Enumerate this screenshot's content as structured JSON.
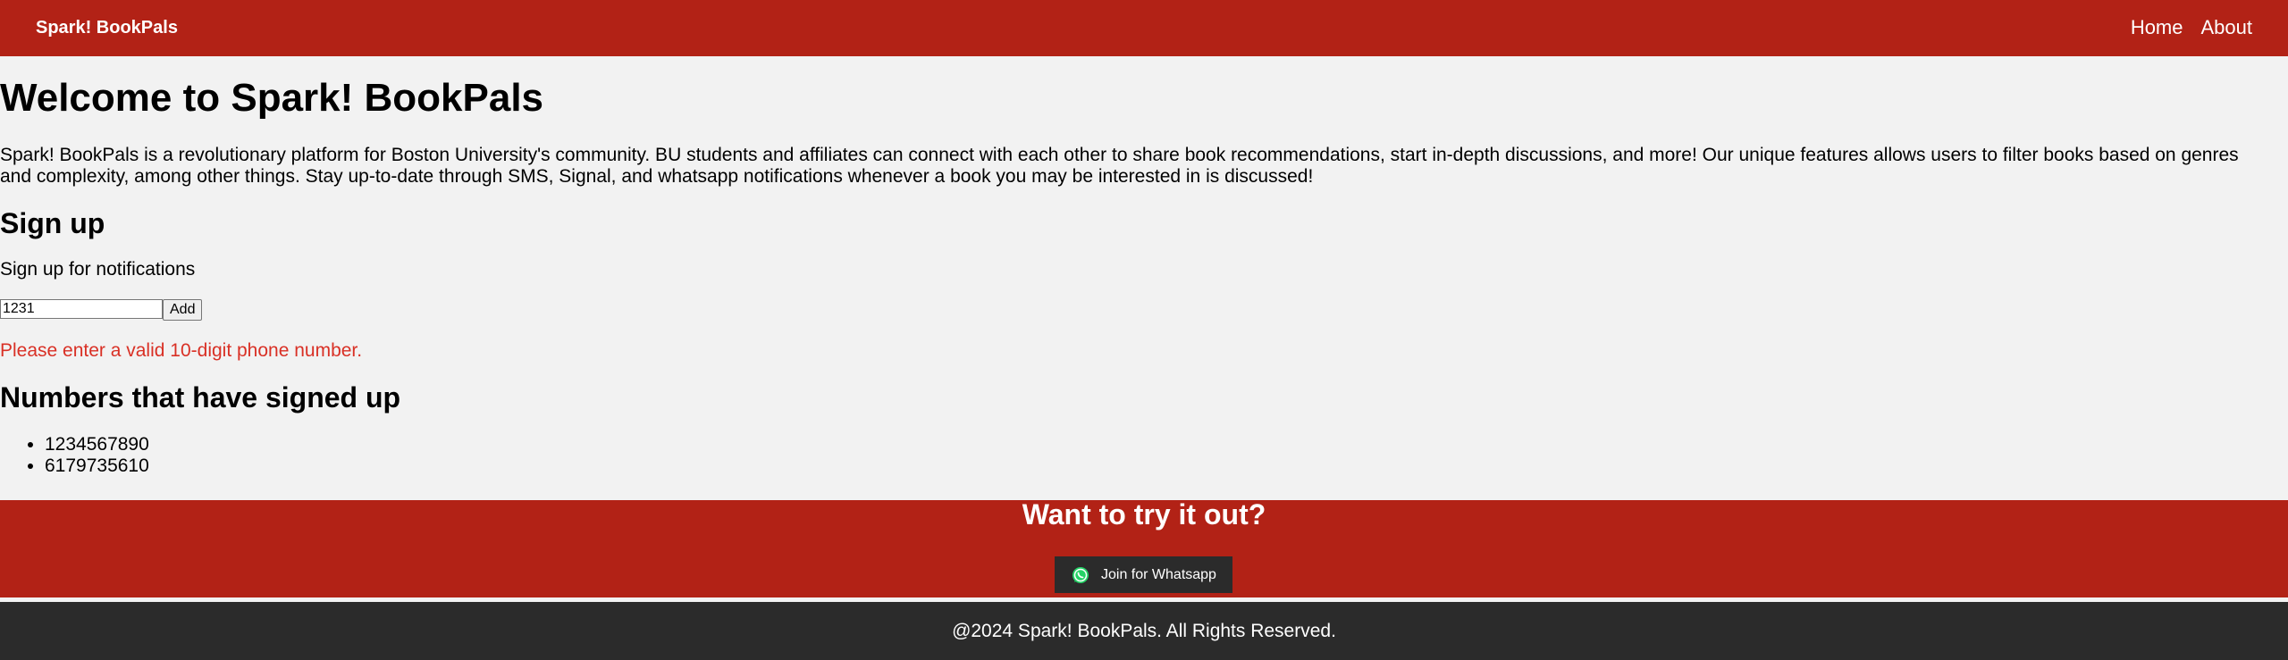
{
  "navbar": {
    "brand": "Spark! BookPals",
    "links": [
      "Home",
      "About"
    ]
  },
  "main": {
    "title": "Welcome to Spark! BookPals",
    "intro": "Spark! BookPals is a revolutionary platform for Boston University's community. BU students and affiliates can connect with each other to share book recommendations, start in-depth discussions, and more! Our unique features allows users to filter books based on genres and complexity, among other things. Stay up-to-date through SMS, Signal, and whatsapp notifications whenever a book you may be interested in is discussed!",
    "signup": {
      "heading": "Sign up",
      "subtext": "Sign up for notifications",
      "input_value": "1231",
      "add_label": "Add",
      "error": "Please enter a valid 10-digit phone number."
    },
    "numbers": {
      "heading": "Numbers that have signed up",
      "items": [
        "1234567890",
        "6179735610"
      ]
    }
  },
  "cta": {
    "heading": "Want to try it out?",
    "button_label": "Join for Whatsapp",
    "icon": "whatsapp-icon"
  },
  "footer": {
    "text": "@2024 Spark! BookPals. All Rights Reserved."
  },
  "colors": {
    "brand_red": "#b22216",
    "dark": "#2b2b2b",
    "error": "#d93025",
    "whatsapp_green": "#25d366",
    "background": "#f2f2f2"
  }
}
